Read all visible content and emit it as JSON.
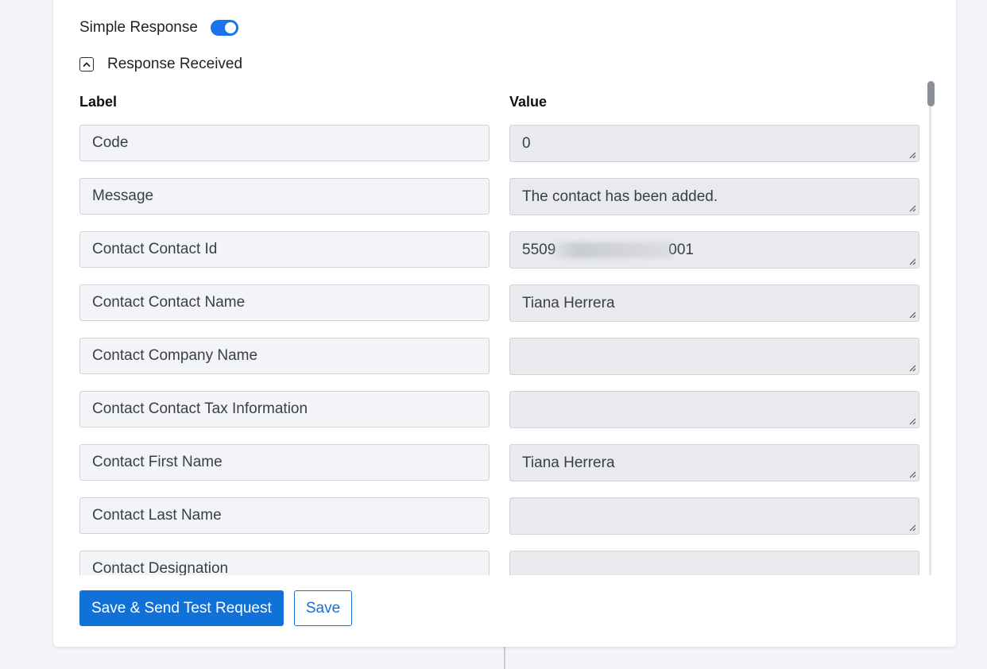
{
  "simple_response": {
    "label": "Simple Response",
    "enabled": true
  },
  "response_received": {
    "label": "Response Received",
    "expanded": true
  },
  "columns": {
    "label": "Label",
    "value": "Value"
  },
  "rows": [
    {
      "label": "Code",
      "value": "0"
    },
    {
      "label": "Message",
      "value": "The contact has been added."
    },
    {
      "label": "Contact Contact Id",
      "value_prefix": "5509",
      "value_suffix": "001"
    },
    {
      "label": "Contact Contact Name",
      "value": "Tiana Herrera"
    },
    {
      "label": "Contact Company Name",
      "value": ""
    },
    {
      "label": "Contact Contact Tax Information",
      "value": ""
    },
    {
      "label": "Contact First Name",
      "value": "Tiana Herrera"
    },
    {
      "label": "Contact Last Name",
      "value": ""
    },
    {
      "label": "Contact Designation",
      "value": ""
    }
  ],
  "actions": {
    "send_test": "Save & Send Test Request",
    "save": "Save"
  },
  "colors": {
    "accent": "#1071d8",
    "toggle_on": "#1a73e8"
  }
}
